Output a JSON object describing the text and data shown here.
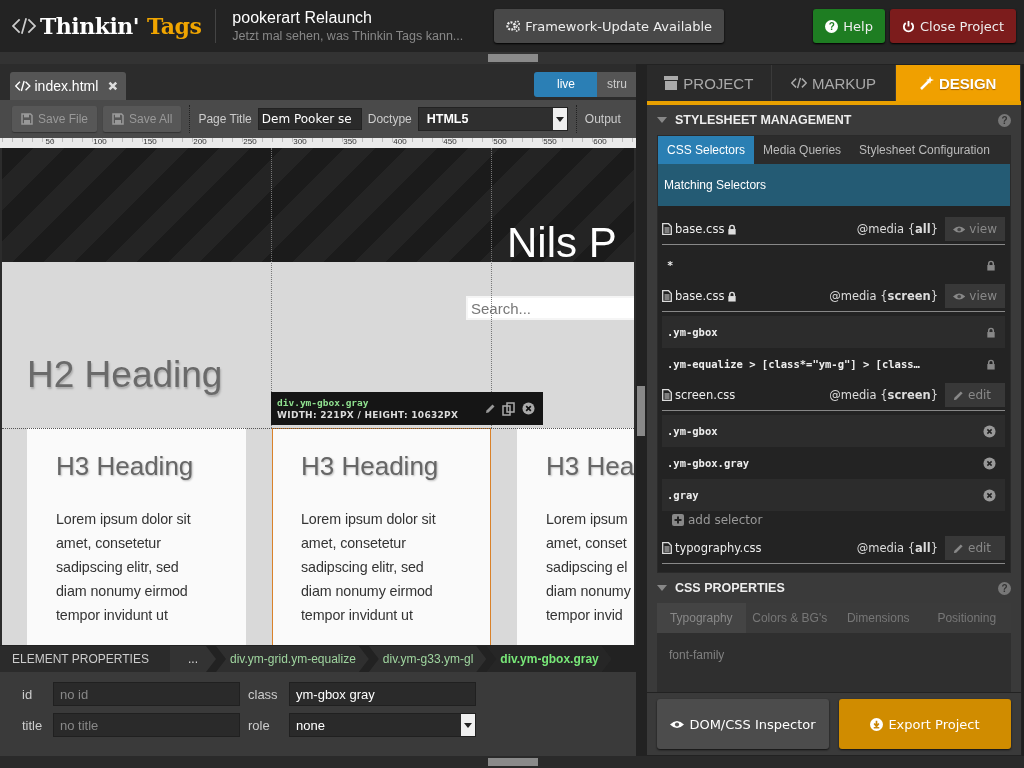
{
  "app": {
    "logo": "Thinkin'",
    "logo_accent": "Tags",
    "project_title": "pookerart Relaunch",
    "project_subtitle": "Jetzt mal sehen, was Thinkin Tags kann...",
    "buttons": [
      {
        "kind": "update",
        "label": "Framework-Update Available"
      },
      {
        "kind": "help",
        "label": "Help",
        "icon": "?"
      },
      {
        "kind": "close",
        "label": "Close Project"
      }
    ]
  },
  "editor": {
    "file_tabs": [
      {
        "label": "index.html",
        "selected": true
      }
    ],
    "view_modes": [
      {
        "label": "live",
        "selected": true
      },
      {
        "label": "stru",
        "selected": false
      }
    ],
    "toolbar": {
      "save_buttons": [
        {
          "label": "Save File",
          "disabled": true
        },
        {
          "label": "Save All",
          "disabled": true
        }
      ],
      "page_title_label": "Page Title",
      "page_title_value": "Dem Pooker se",
      "doctype_label": "Doctype",
      "doctype_value": "HTML5",
      "output_label": "Output"
    },
    "ruler": [
      "50",
      "100",
      "150",
      "200",
      "250",
      "300",
      "350",
      "400",
      "450",
      "500",
      "550",
      "600"
    ],
    "preview": {
      "site_title": "Nils P",
      "search_placeholder": "Search...",
      "h2": "H2 Heading",
      "columns": [
        {
          "heading": "H3 Heading",
          "lines": [
            "Lorem ipsum dolor sit",
            "amet, consetetur",
            "sadipscing elitr, sed",
            "diam nonumy eirmod",
            "tempor invidunt ut"
          ],
          "selected": false
        },
        {
          "heading": "H3 Heading",
          "lines": [
            "Lorem ipsum dolor sit",
            "amet, consetetur",
            "sadipscing elitr, sed",
            "diam nonumy eirmod",
            "tempor invidunt ut"
          ],
          "selected": true
        },
        {
          "heading": "H3 Hea",
          "lines": [
            "Lorem ipsum",
            "amet, conset",
            "sadipscing el",
            "diam nonumy",
            "tempor invid"
          ],
          "selected": false
        }
      ]
    },
    "selection_tooltip": {
      "element": "div.ym-gbox.gray",
      "size": "WIDTH: 221PX / HEIGHT: 10632PX"
    }
  },
  "element_properties": {
    "title": "ELEMENT PROPERTIES",
    "breadcrumb": [
      {
        "label": "...",
        "selected": false
      },
      {
        "label": "div.ym-grid.ym-equalize",
        "selected": false
      },
      {
        "label": "div.ym-g33.ym-gl",
        "selected": false
      },
      {
        "label": "div.ym-gbox.gray",
        "selected": true
      }
    ],
    "fields": [
      {
        "label": "id",
        "kind": "text",
        "placeholder": "no id"
      },
      {
        "label": "class",
        "kind": "text",
        "value": "ym-gbox gray"
      },
      {
        "label": "title",
        "kind": "text",
        "placeholder": "no title"
      },
      {
        "label": "role",
        "kind": "select",
        "value": "none"
      }
    ]
  },
  "sidebar": {
    "tabs": [
      {
        "label": "PROJECT",
        "kind": "project",
        "selected": false
      },
      {
        "label": "MARKUP",
        "kind": "markup",
        "selected": false
      },
      {
        "label": "DESIGN",
        "kind": "design",
        "selected": true
      }
    ],
    "stylesheet_management": {
      "title": "STYLESHEET MANAGEMENT",
      "expanded": true,
      "help": "?",
      "tabs": [
        {
          "label": "CSS Selectors",
          "selected": true
        },
        {
          "label": "Media Queries",
          "selected": false
        },
        {
          "label": "Stylesheet Configuration",
          "selected": false
        }
      ],
      "heading": "Matching Selectors",
      "stylesheets": [
        {
          "file": "base.css",
          "locked": true,
          "media": "@media {**all**}",
          "action": "view",
          "selectors": [
            "*"
          ]
        },
        {
          "file": "base.css",
          "locked": true,
          "media": "@media {**screen**}",
          "action": "view",
          "selectors": [
            ".ym-gbox",
            ".ym-equalize > [class*=\"ym-g\"] > [class…"
          ]
        },
        {
          "file": "screen.css",
          "locked": false,
          "media": "@media {**screen**}",
          "action": "edit",
          "selectors": [
            ".ym-gbox",
            ".ym-gbox.gray",
            ".gray"
          ],
          "add_label": "add selector"
        },
        {
          "file": "typography.css",
          "locked": false,
          "media": "@media {**all**}",
          "action": "edit"
        }
      ]
    },
    "css_properties": {
      "title": "CSS PROPERTIES",
      "expanded": true,
      "disabled": true,
      "help": "?",
      "tabs": [
        {
          "label": "Typography",
          "selected": true
        },
        {
          "label": "Colors & BG's",
          "selected": false
        },
        {
          "label": "Dimensions",
          "selected": false
        },
        {
          "label": "Positioning",
          "selected": false
        }
      ],
      "property": "font-family"
    },
    "bottom_buttons": [
      {
        "kind": "inspector",
        "label": "DOM/CSS Inspector"
      },
      {
        "kind": "export",
        "label": "Export Project"
      }
    ]
  }
}
